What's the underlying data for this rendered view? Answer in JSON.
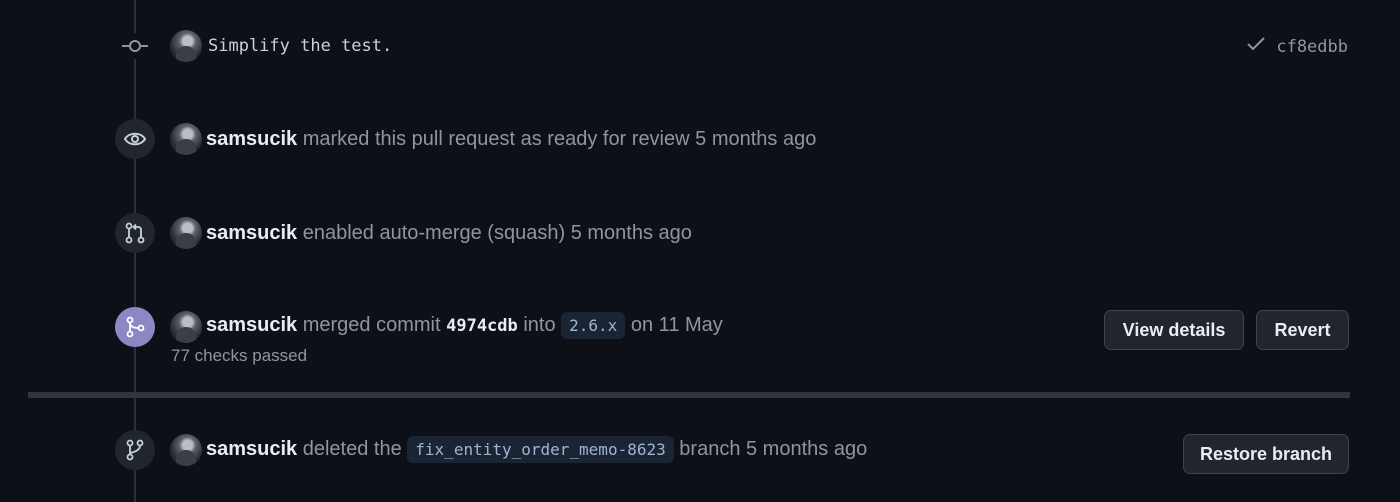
{
  "commit": {
    "message": "Simplify the test.",
    "sha": "cf8edbb",
    "status_icon": "check-icon"
  },
  "events": {
    "ready": {
      "author": "samsucik",
      "action": "marked this pull request as ready for review",
      "time": "5 months ago",
      "icon": "eye-icon"
    },
    "automerge": {
      "author": "samsucik",
      "action": "enabled auto-merge (squash)",
      "time": "5 months ago",
      "icon": "pull-request-icon"
    },
    "merged": {
      "author": "samsucik",
      "action_pre": "merged commit",
      "sha": "4974cdb",
      "into": "into",
      "branch": "2.6.x",
      "date": "on 11 May",
      "checks": "77 checks passed",
      "icon": "merge-icon",
      "badge_color": "#8b88c4",
      "view_details_label": "View details",
      "revert_label": "Revert"
    },
    "deleted": {
      "author": "samsucik",
      "action_pre": "deleted the",
      "branch": "fix_entity_order_memo-8623",
      "action_post": "branch 5 months ago",
      "icon": "branch-icon",
      "restore_label": "Restore branch"
    }
  }
}
